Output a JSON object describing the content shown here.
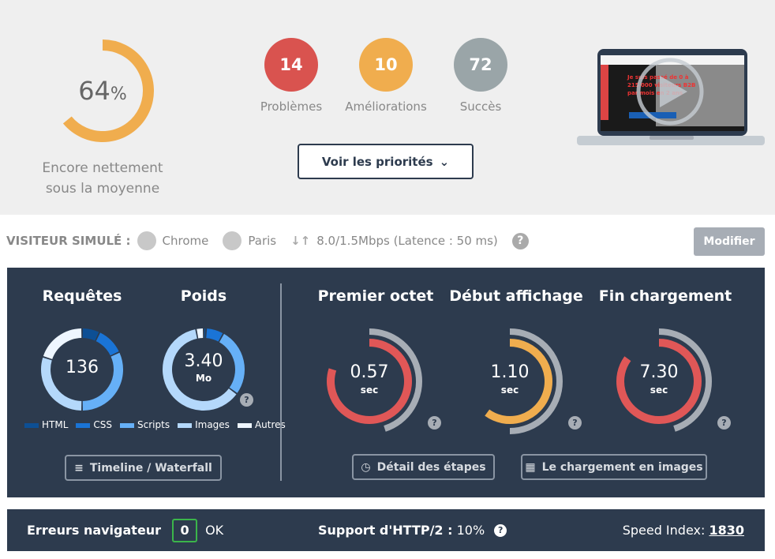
{
  "score": {
    "value": "64",
    "unit": "%",
    "fraction": 0.64,
    "color": "#f0ad4e",
    "label_line1": "Encore nettement",
    "label_line2": "sous la moyenne"
  },
  "counts": [
    {
      "value": "14",
      "label": "Problèmes",
      "color": "#d9534f"
    },
    {
      "value": "10",
      "label": "Améliorations",
      "color": "#f0ad4e"
    },
    {
      "value": "72",
      "label": "Succès",
      "color": "#9aa5a8"
    }
  ],
  "priorities_button": "Voir les priorités",
  "visitor": {
    "label": "VISITEUR SIMULÉ :",
    "browser": "Chrome",
    "location": "Paris",
    "connection": "8.0/1.5Mbps (Latence : 50 ms)",
    "help": "?",
    "modify_button": "Modifier"
  },
  "requests": {
    "title": "Requêtes",
    "value": "136",
    "segments": [
      0.07,
      0.11,
      0.32,
      0.3,
      0.2
    ]
  },
  "weight": {
    "title": "Poids",
    "value": "3.40",
    "unit": "Mo",
    "segments": [
      0.01,
      0.07,
      0.27,
      0.62,
      0.03
    ]
  },
  "legend": [
    {
      "label": "HTML",
      "color": "#0d4f94"
    },
    {
      "label": "CSS",
      "color": "#1a74d6"
    },
    {
      "label": "Scripts",
      "color": "#66b0f7"
    },
    {
      "label": "Images",
      "color": "#b4d8fb"
    },
    {
      "label": "Autres",
      "color": "#eef6ff"
    }
  ],
  "timings": [
    {
      "title": "Premier octet",
      "value": "0.57",
      "unit": "sec",
      "fraction": 0.8,
      "ref": 0.45,
      "color": "#e05757"
    },
    {
      "title": "Début affichage",
      "value": "1.10",
      "unit": "sec",
      "fraction": 0.6,
      "ref": 0.5,
      "color": "#f0ad4e"
    },
    {
      "title": "Fin chargement",
      "value": "7.30",
      "unit": "sec",
      "fraction": 0.85,
      "ref": 0.45,
      "color": "#e05757"
    }
  ],
  "buttons": {
    "timeline": "Timeline / Waterfall",
    "steps": "Détail des étapes",
    "images": "Le chargement en images"
  },
  "bottom": {
    "errors_label": "Erreurs navigateur",
    "errors_count": "0",
    "errors_status": "OK",
    "http2_label": "Support d'HTTP/2 :",
    "http2_value": "10%",
    "speed_label": "Speed Index:",
    "speed_value": "1830"
  }
}
